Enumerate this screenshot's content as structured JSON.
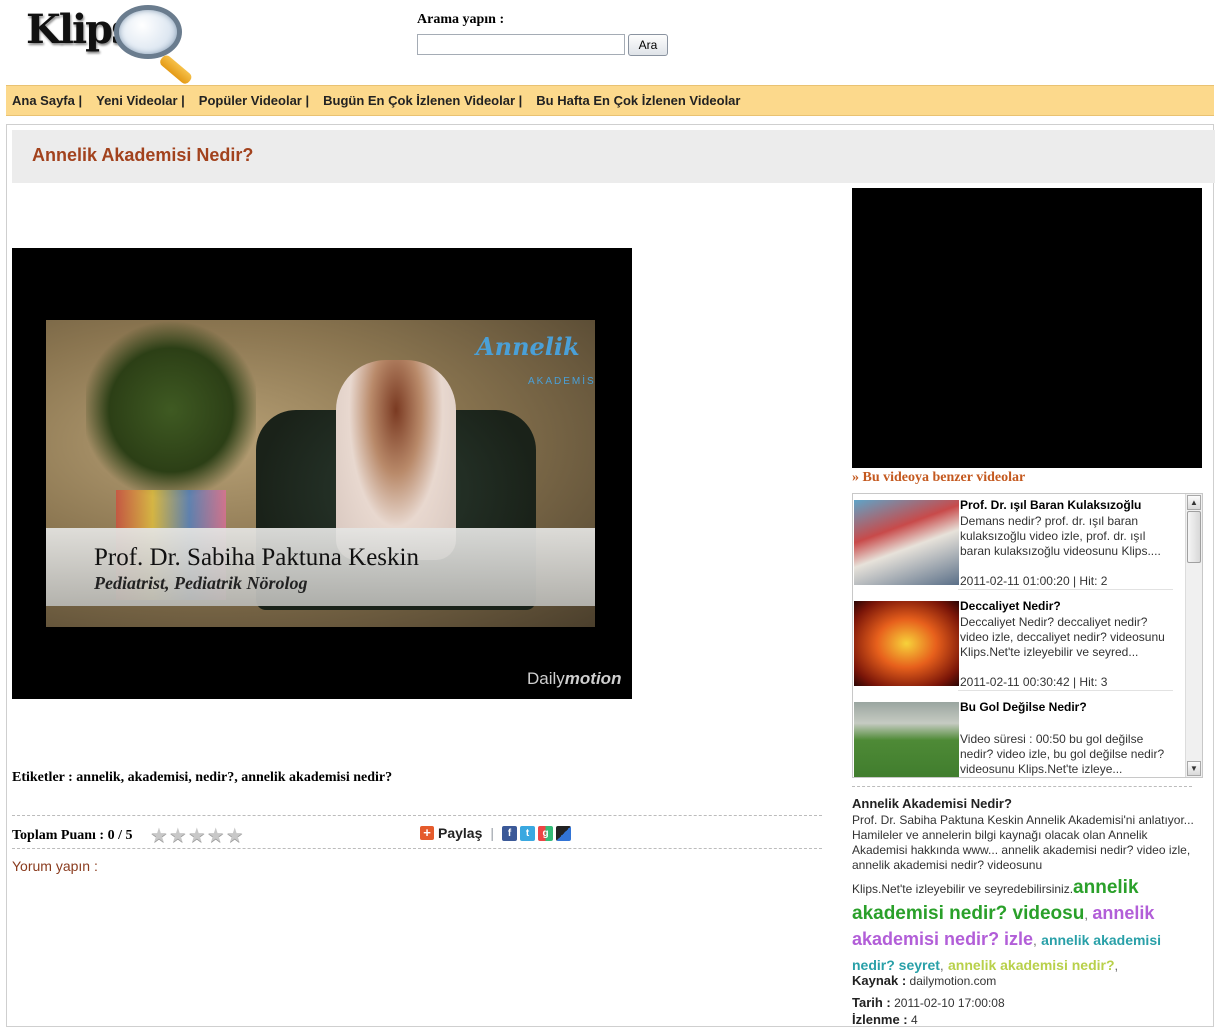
{
  "header": {
    "logo_text": "Klips",
    "search_label": "Arama yapın :",
    "search_value": "",
    "search_button": "Ara"
  },
  "nav": {
    "items": [
      "Ana Sayfa |",
      "Yeni Videolar |",
      "Popüler Videolar |",
      "Bugün En Çok İzlenen Videolar |",
      "Bu Hafta En Çok İzlenen Videolar"
    ]
  },
  "page": {
    "title": "Annelik Akademisi Nedir?"
  },
  "video": {
    "caption_name": "Prof. Dr. Sabiha Paktuna Keskin",
    "caption_role": "Pediatrist, Pediatrik Nörolog",
    "brand": "Annelik",
    "brand_sub": "AKADEMİSİ",
    "provider_logo_a": "Daily",
    "provider_logo_b": "motion"
  },
  "tags": "Etiketler : annelik, akademisi, nedir?, annelik akademisi nedir?",
  "rating": {
    "label": "Toplam Puanı : 0 / 5",
    "stars": "★★★★★",
    "value": 0,
    "max": 5
  },
  "share": {
    "label": "Paylaş",
    "divider": "|",
    "networks": [
      "facebook-icon",
      "twitter-icon",
      "google-icon",
      "delicious-icon"
    ]
  },
  "comment_label": "Yorum yapın :",
  "sidebar": {
    "similar_heading_prefix": "»",
    "similar_heading": "Bu videoya benzer videolar",
    "items": [
      {
        "title": "Prof. Dr. ışıl Baran Kulaksızoğlu",
        "desc": "Demans nedir? prof. dr. ışıl baran kulaksızoğlu video izle, prof. dr. ışıl baran kulaksızoğlu videosunu Klips....",
        "meta": "2011-02-11 01:00:20 | Hit: 2"
      },
      {
        "title": "Deccaliyet Nedir?",
        "desc": "Deccaliyet Nedir? deccaliyet nedir? video izle, deccaliyet nedir? videosunu Klips.Net'te izleyebilir ve seyred...",
        "meta": "2011-02-11 00:30:42 | Hit: 3"
      },
      {
        "title": "Bu Gol Değilse Nedir?",
        "desc": "Video süresi : 00:50 bu gol değilse nedir? video izle, bu gol değilse nedir? videosunu Klips.Net'te izleye...",
        "meta": ""
      }
    ],
    "desc_title": "Annelik Akademisi Nedir?",
    "desc": "Prof. Dr. Sabiha Paktuna Keskin Annelik Akademisi'ni anlatıyor... Hamileler ve annelerin bilgi kaynağı olacak olan Annelik Akademisi hakkında www... annelik akademisi nedir? video izle, annelik akademisi nedir? videosunu",
    "desc_tail": "Klips.Net'te izleyebilir ve seyredebilirsiniz.",
    "keywords": [
      "annelik akademisi nedir? videosu",
      "annelik akademisi nedir? izle",
      "annelik akademisi nedir? seyret",
      "annelik akademisi nedir?"
    ],
    "keyword_sep": ",",
    "source_label": "Kaynak :",
    "source_value": "dailymotion.com",
    "date_label": "Tarih :",
    "date_value": "2011-02-10 17:00:08",
    "views_label": "İzlenme :",
    "views_value": "4"
  }
}
